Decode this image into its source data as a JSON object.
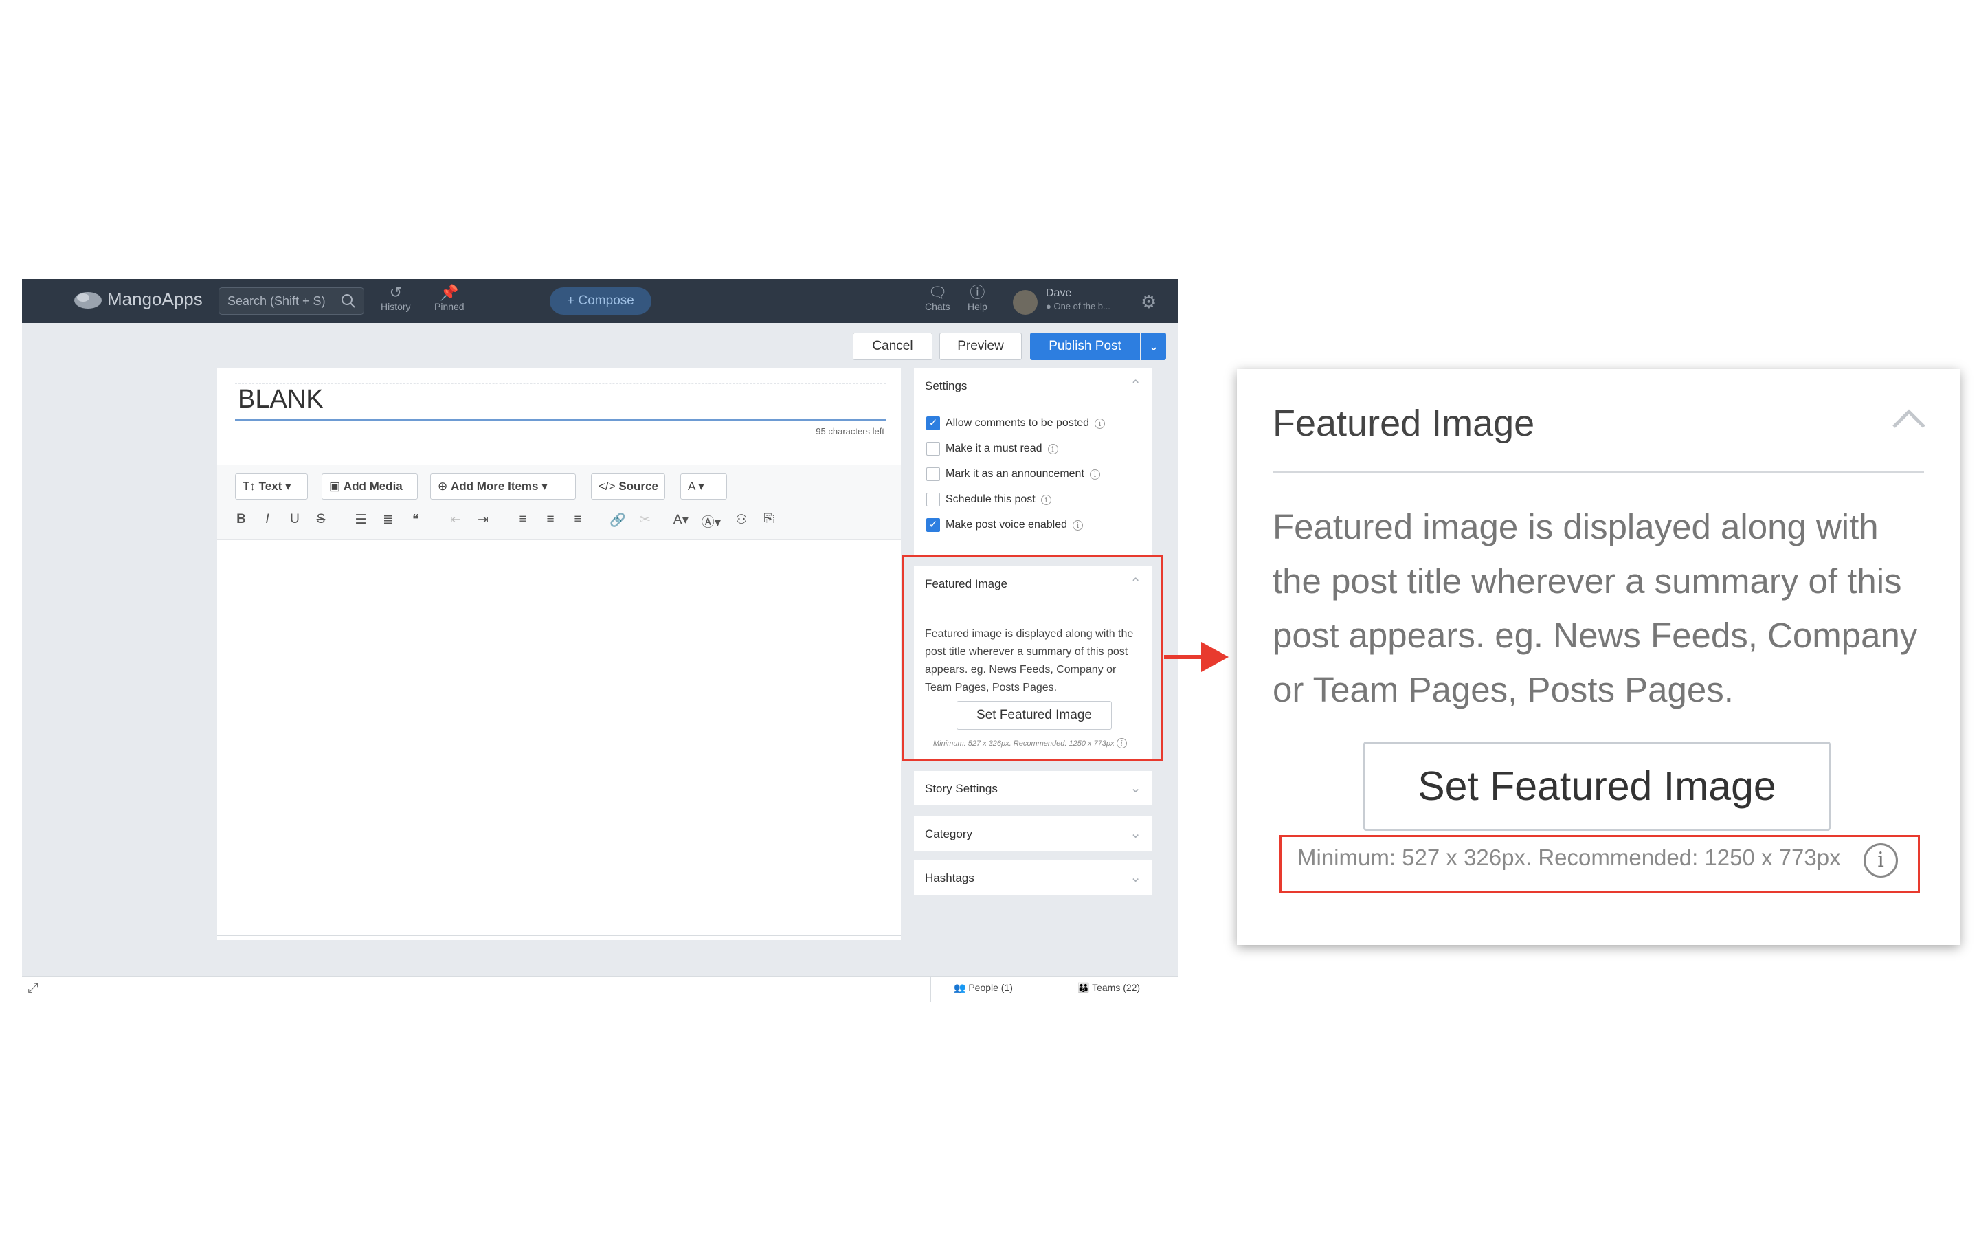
{
  "app": {
    "logo_text": "MangoApps",
    "search_placeholder": "Search (Shift + S)",
    "nav": [
      {
        "label": "History",
        "icon": "history-icon"
      },
      {
        "label": "Pinned",
        "icon": "pin-icon"
      }
    ],
    "compose_label": "+ Compose",
    "right_nav": [
      {
        "label": "Chats",
        "icon": "chat-icon"
      },
      {
        "label": "Help",
        "icon": "help-icon"
      }
    ],
    "user": {
      "name": "Dave",
      "status": "One of the b..."
    }
  },
  "actions": {
    "cancel": "Cancel",
    "preview": "Preview",
    "publish": "Publish Post"
  },
  "editor": {
    "title": "BLANK",
    "chars_left": "95 characters left",
    "toolbar": {
      "text": "Text",
      "add_media": "Add Media",
      "add_more": "Add More Items",
      "source": "Source",
      "font_color": "A"
    }
  },
  "settings": {
    "title": "Settings",
    "options": [
      {
        "label": "Allow comments to be posted",
        "checked": true
      },
      {
        "label": "Make it a must read",
        "checked": false
      },
      {
        "label": "Mark it as an announcement",
        "checked": false
      },
      {
        "label": "Schedule this post",
        "checked": false
      },
      {
        "label": "Make post voice enabled",
        "checked": true
      }
    ]
  },
  "featured_image": {
    "title": "Featured Image",
    "description": "Featured image is displayed along with the post title wherever a summary of this post appears. eg. News Feeds, Company or Team Pages, Posts Pages.",
    "button": "Set Featured Image",
    "size_hint": "Minimum: 527 x 326px. Recommended: 1250 x 773px"
  },
  "collapsed_panels": [
    "Story Settings",
    "Category",
    "Hashtags"
  ],
  "footer": {
    "people": "People (1)",
    "teams": "Teams (22)"
  },
  "colors": {
    "accent": "#2d7ee0",
    "highlight": "#e83a2e",
    "topbar": "#2e3845"
  }
}
